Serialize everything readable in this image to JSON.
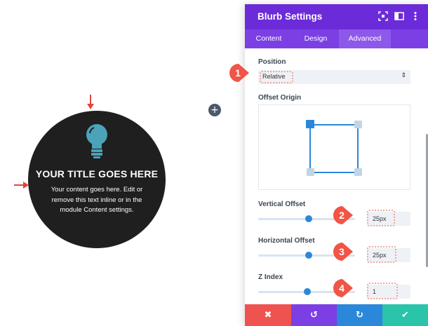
{
  "canvas": {
    "blurb_title": "YOUR TITLE GOES HERE",
    "blurb_body": "Your content goes here. Edit or remove this text inline or in the module Content settings.",
    "add_glyph": "+",
    "icon": "lightbulb-icon"
  },
  "panel": {
    "title": "Blurb Settings",
    "header_icons": [
      "expand-icon",
      "sidebar-toggle-icon",
      "more-options-icon"
    ],
    "tabs": [
      {
        "label": "Content",
        "active": false
      },
      {
        "label": "Design",
        "active": false
      },
      {
        "label": "Advanced",
        "active": true
      }
    ],
    "position": {
      "label": "Position",
      "value": "Relative",
      "caret": "⇕"
    },
    "offset_origin": {
      "label": "Offset Origin"
    },
    "vertical_offset": {
      "label": "Vertical Offset",
      "value": "25px"
    },
    "horizontal_offset": {
      "label": "Horizontal Offset",
      "value": "25px"
    },
    "z_index": {
      "label": "Z Index",
      "value": "1"
    },
    "footer": {
      "cancel": "✖",
      "undo": "↺",
      "redo": "↻",
      "save": "✔"
    }
  },
  "annotations": {
    "badges": [
      "1",
      "2",
      "3",
      "4"
    ]
  },
  "colors": {
    "header": "#6c2bd9",
    "tabs": "#7b3fe4",
    "accent_blue": "#2b87da",
    "cancel": "#ef5350",
    "undo": "#7b3fe4",
    "redo": "#2b87da",
    "save": "#29c4a9",
    "badge": "#f05545"
  }
}
